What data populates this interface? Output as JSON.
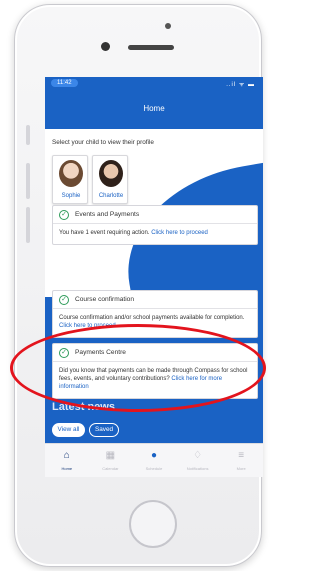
{
  "status_bar": {
    "time": "11:42",
    "icons": "..il ᯤ ▬"
  },
  "header": {
    "title": "Home"
  },
  "profile_select": {
    "prompt": "Select your child to view their profile",
    "children": [
      {
        "name": "Sophie"
      },
      {
        "name": "Charlotte"
      }
    ]
  },
  "cards": [
    {
      "title": "Events and Payments",
      "body": "You have 1 event requiring action.",
      "link": "Click here to proceed"
    },
    {
      "title": "Course confirmation",
      "body": "Course confirmation and/or school payments available for completion.",
      "link": "Click here to proceed"
    },
    {
      "title": "Payments Centre",
      "body": "Did you know that payments can be made through Compass for school fees, events, and voluntary contributions?",
      "link": "Click here for more information"
    }
  ],
  "news": {
    "heading": "Latest news",
    "view_all": "View all",
    "saved": "Saved"
  },
  "tabs": [
    {
      "label": "Home",
      "icon": "home-icon",
      "glyph": "⌂",
      "active": true
    },
    {
      "label": "Calendar",
      "icon": "calendar-icon",
      "glyph": "▦",
      "active": false
    },
    {
      "label": "Schedule",
      "icon": "add-icon",
      "glyph": "●",
      "active": false
    },
    {
      "label": "Notifications",
      "icon": "bell-icon",
      "glyph": "♢",
      "active": false
    },
    {
      "label": "More",
      "icon": "menu-icon",
      "glyph": "≡",
      "active": false
    }
  ],
  "colors": {
    "brand_blue": "#1a62c4",
    "highlight_red": "#e3141d",
    "check_green": "#2e9b5a"
  }
}
